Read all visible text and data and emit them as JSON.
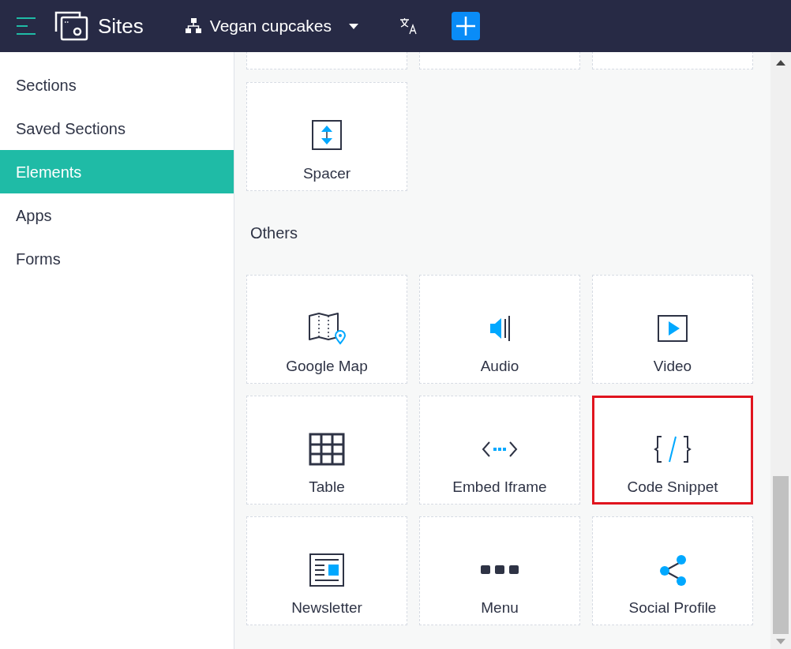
{
  "header": {
    "app_name": "Sites",
    "site_name": "Vegan cupcakes"
  },
  "sidebar": {
    "items": [
      {
        "label": "Sections",
        "selected": false
      },
      {
        "label": "Saved Sections",
        "selected": false
      },
      {
        "label": "Elements",
        "selected": true
      },
      {
        "label": "Apps",
        "selected": false
      },
      {
        "label": "Forms",
        "selected": false
      }
    ]
  },
  "spacer_group": {
    "elements": [
      {
        "label": "Spacer",
        "kind": "spacer",
        "highlighted": false
      }
    ]
  },
  "others_group": {
    "title": "Others",
    "elements": [
      {
        "label": "Google Map",
        "kind": "map",
        "highlighted": false
      },
      {
        "label": "Audio",
        "kind": "audio",
        "highlighted": false
      },
      {
        "label": "Video",
        "kind": "video",
        "highlighted": false
      },
      {
        "label": "Table",
        "kind": "table",
        "highlighted": false
      },
      {
        "label": "Embed Iframe",
        "kind": "iframe",
        "highlighted": false
      },
      {
        "label": "Code Snippet",
        "kind": "code",
        "highlighted": true
      },
      {
        "label": "Newsletter",
        "kind": "newsletter",
        "highlighted": false
      },
      {
        "label": "Menu",
        "kind": "menu",
        "highlighted": false
      },
      {
        "label": "Social Profile",
        "kind": "social",
        "highlighted": false
      }
    ]
  }
}
